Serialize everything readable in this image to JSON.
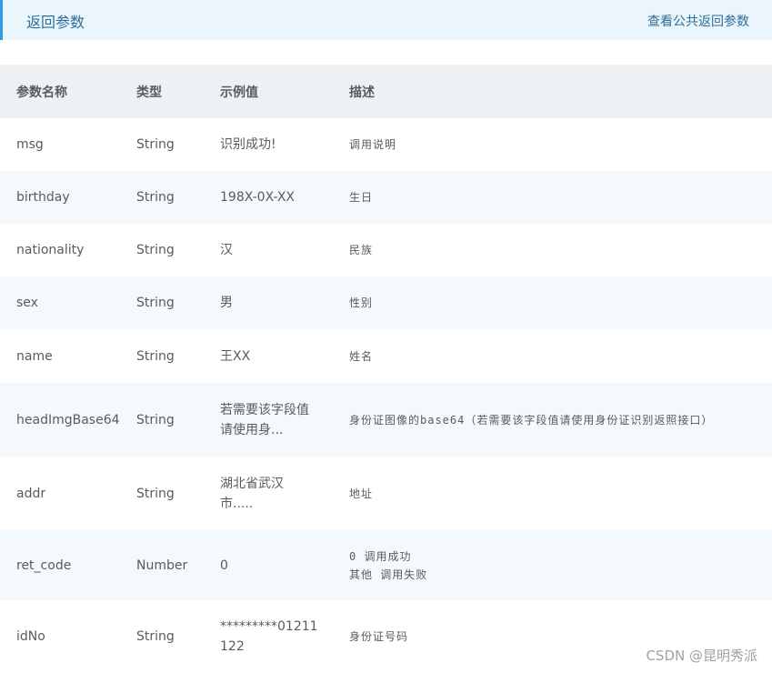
{
  "header": {
    "title": "返回参数",
    "link": "查看公共返回参数"
  },
  "table": {
    "columns": [
      "参数名称",
      "类型",
      "示例值",
      "描述"
    ],
    "rows": [
      {
        "name": "msg",
        "type": "String",
        "example": "识别成功!",
        "desc": "调用说明"
      },
      {
        "name": "birthday",
        "type": "String",
        "example": "198X-0X-XX",
        "desc": "生日"
      },
      {
        "name": "nationality",
        "type": "String",
        "example": "汉",
        "desc": "民族"
      },
      {
        "name": "sex",
        "type": "String",
        "example": "男",
        "desc": "性别"
      },
      {
        "name": "name",
        "type": "String",
        "example": "王XX",
        "desc": "姓名"
      },
      {
        "name": "headImgBase64",
        "type": "String",
        "example": "若需要该字段值请使用身...",
        "desc": "身份证图像的base64（若需要该字段值请使用身份证识别返照接口）"
      },
      {
        "name": "addr",
        "type": "String",
        "example": "湖北省武汉市.....",
        "desc": "地址"
      },
      {
        "name": "ret_code",
        "type": "Number",
        "example": "0",
        "desc": "0 调用成功\n其他 调用失败"
      },
      {
        "name": "idNo",
        "type": "String",
        "example": "*********01211122",
        "desc": "身份证号码"
      }
    ]
  },
  "watermark": "CSDN @昆明秀派"
}
